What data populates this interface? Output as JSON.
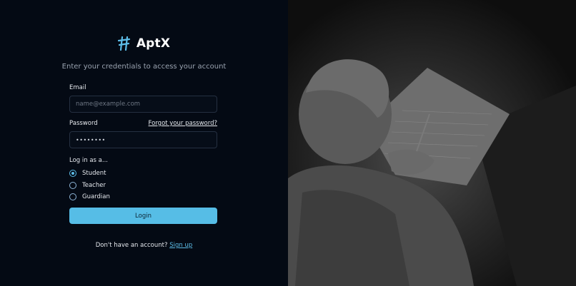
{
  "brand": {
    "name": "AptX",
    "icon": "aptx-logo-icon"
  },
  "subtitle": "Enter your credentials to access your account",
  "email": {
    "label": "Email",
    "placeholder": "name@example.com",
    "value": ""
  },
  "password": {
    "label": "Password",
    "value": "••••••••",
    "forgot_label": "Forgot your password?"
  },
  "role": {
    "label": "Log in as a...",
    "options": [
      {
        "label": "Student",
        "selected": true
      },
      {
        "label": "Teacher",
        "selected": false
      },
      {
        "label": "Guardian",
        "selected": false
      }
    ]
  },
  "login_button": "Login",
  "signup": {
    "prompt": "Don't have an account?",
    "link": "Sign up"
  },
  "colors": {
    "accent": "#56bde6",
    "background": "#040a14"
  }
}
